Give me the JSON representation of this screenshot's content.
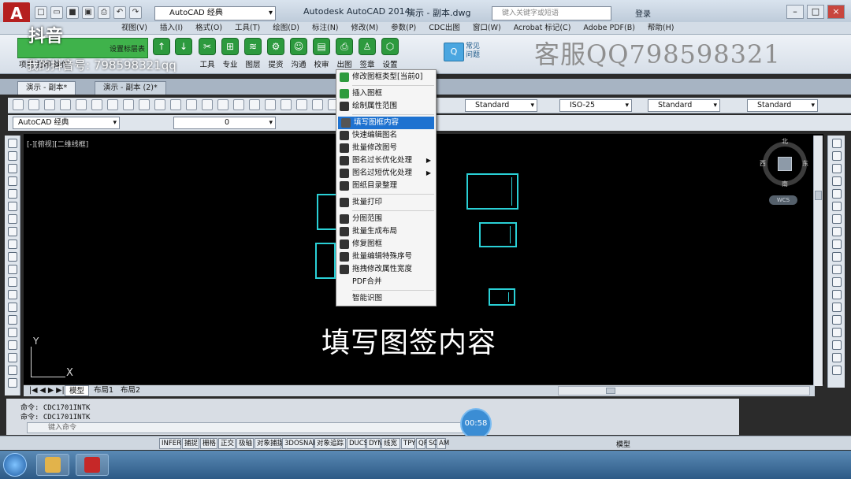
{
  "window": {
    "title": "Autodesk AutoCAD 2014",
    "file": "演示 - 副本.dwg",
    "workspace": "AutoCAD 经典",
    "search_placeholder": "键入关键字或短语",
    "login": "登录"
  },
  "menubar": [
    "视图(V)",
    "插入(I)",
    "格式(O)",
    "工具(T)",
    "绘图(D)",
    "标注(N)",
    "修改(M)",
    "参数(P)",
    "CDC出图",
    "窗口(W)",
    "Acrobat 标记(C)",
    "Adobe PDF(B)",
    "帮助(H)"
  ],
  "ribbon": {
    "green_label": "设置标层表",
    "left_labels": "项目  打印  操作",
    "tools": [
      "工具",
      "专业",
      "图层",
      "提资",
      "沟通",
      "校审",
      "出图",
      "签章",
      "设置"
    ],
    "help_label": "常见问题",
    "help_icon": "Q"
  },
  "overlay": {
    "tiktok_logo": "抖音",
    "tiktok_id": "我的抖音号: 798598321qq",
    "watermark": "客服QQ798598321",
    "caption": "填写图签内容"
  },
  "doc_tabs": [
    "演示 - 副本*",
    "演示 - 副本 (2)*"
  ],
  "toolbar": {
    "styles": [
      "Standard",
      "ISO-25",
      "Standard",
      "Standard"
    ],
    "workspace": "AutoCAD 经典",
    "layer": "0"
  },
  "drawing": {
    "view_label": "[-][俯视][二维线框]",
    "compass": {
      "n": "北",
      "s": "南",
      "e": "东",
      "w": "西"
    },
    "wcs": "WCS",
    "ucs_x": "X",
    "ucs_y": "Y"
  },
  "context_menu": {
    "items": [
      {
        "label": "修改图框类型[当前0]",
        "icon": "gear-icon",
        "color": "#2e9b3e"
      },
      {
        "sep": true
      },
      {
        "label": "插入图框",
        "icon": "insert-frame-icon",
        "color": "#2e9b3e"
      },
      {
        "label": "绘制属性范围",
        "icon": "attribute-range-icon",
        "color": "#333333"
      },
      {
        "sep": true
      },
      {
        "label": "填写图框内容",
        "icon": "edit-frame-icon",
        "color": "#555555",
        "highlight": true
      },
      {
        "label": "快速编辑图名",
        "icon": "tag-icon",
        "color": "#333333"
      },
      {
        "label": "批量修改图号",
        "icon": "dollar-icon",
        "color": "#333333"
      },
      {
        "label": "图名过长优化处理",
        "icon": "font-icon",
        "color": "#333333",
        "submenu": true
      },
      {
        "label": "图名过短优化处理",
        "icon": "font-icon",
        "color": "#333333",
        "submenu": true
      },
      {
        "label": "图纸目录整理",
        "icon": "list-icon",
        "color": "#333333"
      },
      {
        "sep": true
      },
      {
        "label": "批量打印",
        "icon": "printer-icon",
        "color": "#333333"
      },
      {
        "sep": true
      },
      {
        "label": "分图范围",
        "icon": "split-icon",
        "color": "#333333"
      },
      {
        "label": "批量生成布局",
        "icon": "layout-icon",
        "color": "#333333"
      },
      {
        "label": "修复图框",
        "icon": "plus-circle-icon",
        "color": "#333333"
      },
      {
        "label": "批量编辑特殊序号",
        "icon": "pencil-icon",
        "color": "#333333"
      },
      {
        "label": "拖拽修改属性宽度",
        "icon": "pencil-icon",
        "color": "#333333"
      },
      {
        "label": "PDF合并",
        "icon": "",
        "color": ""
      },
      {
        "sep": true
      },
      {
        "label": "智能识图",
        "icon": "",
        "color": ""
      }
    ]
  },
  "layout_tabs": [
    "模型",
    "布局1",
    "布局2"
  ],
  "command": {
    "lines": [
      "命令:  CDC1701INTK",
      "命令:  CDC1701INTK"
    ],
    "input_placeholder": "键入命令"
  },
  "timer": "00:58",
  "status": {
    "coord": "",
    "buttons": [
      "INFER",
      "捕捉",
      "栅格",
      "正交",
      "极轴",
      "对象捕捉",
      "3DOSNAP",
      "对象追踪",
      "DUCS",
      "DYN",
      "线宽",
      "TPY",
      "QP",
      "SC",
      "AM"
    ],
    "model": "模型"
  },
  "colors": {
    "frame": "#2ad0d6",
    "highlight": "#1e72d0",
    "ribbon_green": "#3fb24b"
  }
}
